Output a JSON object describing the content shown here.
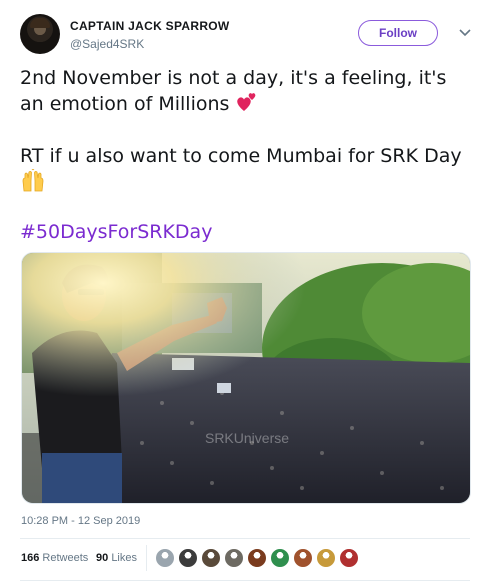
{
  "user": {
    "display_name": "CAPTAIN JACK SPARROW",
    "handle": "@Sajed4SRK",
    "follow_label": "Follow"
  },
  "tweet": {
    "line1": "2nd November is not a day, it's a feeling, it's an emotion of Millions",
    "line2": "RT if u also want to come Mumbai for SRK Day",
    "hashtag": "#50DaysForSRKDay",
    "emoji1": "two-hearts-emoji",
    "emoji2": "raising-hands-emoji",
    "photo_watermark": "SRKUniverse",
    "timestamp": "10:28 PM - 12 Sep 2019"
  },
  "stats": {
    "retweets_count": "166",
    "retweets_label": "Retweets",
    "likes_count": "90",
    "likes_label": "Likes"
  },
  "likers": [
    {
      "name": "liker-avatar-1",
      "color": "#9aa5ae"
    },
    {
      "name": "liker-avatar-2",
      "color": "#3c3c3c"
    },
    {
      "name": "liker-avatar-3",
      "color": "#5a4a3a"
    },
    {
      "name": "liker-avatar-4",
      "color": "#6d6a62"
    },
    {
      "name": "liker-avatar-5",
      "color": "#7a3b1e"
    },
    {
      "name": "liker-avatar-6",
      "color": "#2f8f4e"
    },
    {
      "name": "liker-avatar-7",
      "color": "#a0522d"
    },
    {
      "name": "liker-avatar-8",
      "color": "#c79a3a"
    },
    {
      "name": "liker-avatar-9",
      "color": "#b03030"
    }
  ],
  "colors": {
    "accent": "#7b2bd0",
    "follow_border": "#8b5bdc",
    "secondary_text": "#657786"
  }
}
